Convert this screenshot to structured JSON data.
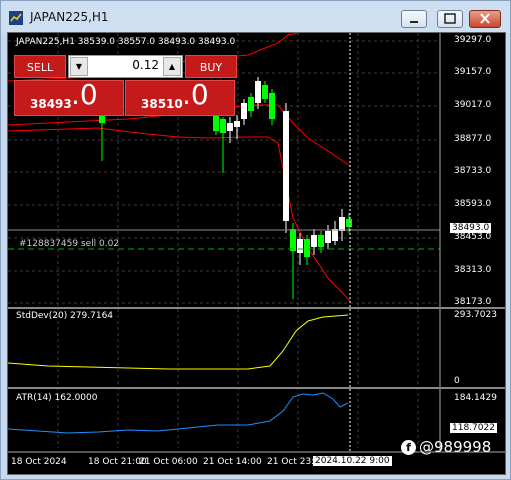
{
  "window": {
    "title": "JAPAN225,H1"
  },
  "chart": {
    "symbol_info": "JAPAN225,H1  38539.0 38557.0 38493.0 38493.0",
    "price_labels": [
      "39297.0",
      "39157.0",
      "39017.0",
      "38877.0",
      "38733.0",
      "38593.0",
      "38453.0",
      "38313.0",
      "38173.0"
    ],
    "current_price": "38493.0",
    "order_line_label": "#128837459 sell 0.02",
    "time_labels": [
      "18 Oct 2024",
      "18 Oct 21:00",
      "21 Oct 06:00",
      "21 Oct 14:00",
      "21 Oct 23:"
    ],
    "crosshair_time": "2024.10.22 9:00",
    "colors": {
      "background": "#000000",
      "bull_candle": "#ffffff",
      "bear_candle": "#00ff00",
      "bands": "#ff0000",
      "stddev": "#ffff00",
      "atr": "#1e90ff"
    }
  },
  "trade_panel": {
    "sell_label": "SELL",
    "buy_label": "BUY",
    "lot_value": "0.12",
    "sell_price_main": "38493",
    "sell_price_frac": ".0",
    "buy_price_main": "38510",
    "buy_price_frac": ".0"
  },
  "stddev": {
    "label": "StdDev(20) 279.7164",
    "axis_top": "293.7023",
    "axis_bottom": "0"
  },
  "atr": {
    "label": "ATR(14) 162.0000",
    "axis_top": "184.1429",
    "axis_bottom": "118.7022"
  },
  "watermark": "@989998"
}
